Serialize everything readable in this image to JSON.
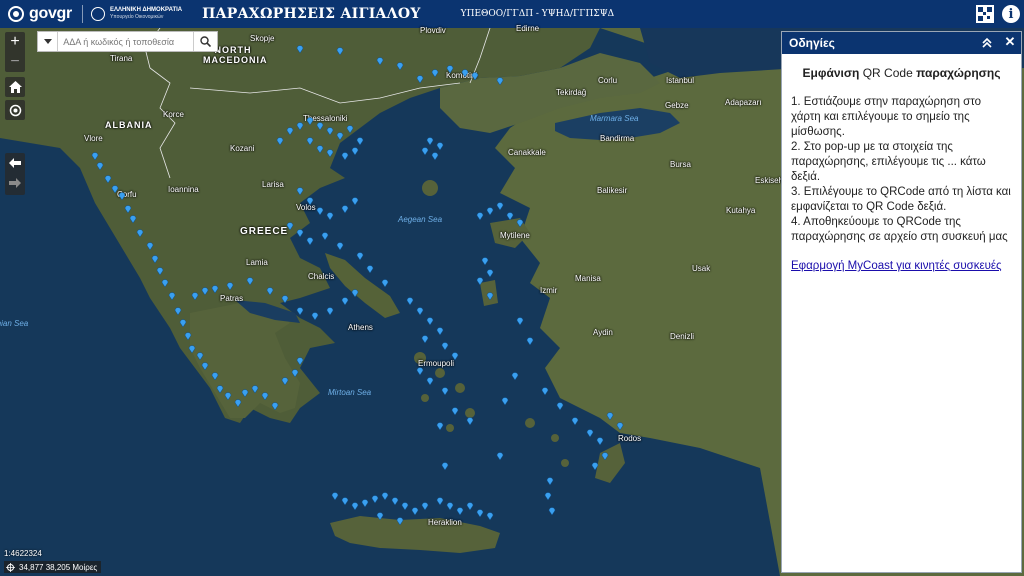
{
  "header": {
    "logo": "govgr",
    "gov_line1": "ΕΛΛΗΝΙΚΗ ΔΗΜΟΚΡΑΤΙΑ",
    "gov_line2": "Υπουργείο Οικονομικών",
    "title": "ΠΑΡΑΧΩΡΗΣΕΙΣ ΑΙΓΙΑΛΟΥ",
    "ministry": "ΥΠΕΘΟΟ/ΓΓΔΠ - ΥΨΗΔ/ΓΓΠΣΨΔ",
    "qr_icon": "qr-code-icon",
    "info_icon": "info-icon",
    "info_label": "i"
  },
  "map_controls": {
    "zoom_in": "+",
    "zoom_out": "−",
    "home_icon": "home-icon",
    "locate_icon": "locate-icon",
    "back_icon": "arrow-left-icon",
    "forward_icon": "arrow-right-icon"
  },
  "search": {
    "placeholder": "ΑΔΑ ή κωδικός ή τοποθεσία"
  },
  "map_labels": {
    "countries": [
      "NORTH MACEDONIA",
      "ALBANIA",
      "GREECE"
    ],
    "seas": [
      "Aegean Sea",
      "Marmara Sea",
      "Mirtoan Sea",
      "Ionian Sea"
    ],
    "cities": [
      "Tirana",
      "Skopje",
      "Plovdiv",
      "Edirne",
      "Istanbul",
      "Gebze",
      "Adapazarı",
      "Komotini",
      "Corlu",
      "Tekirdağ",
      "Bandirma",
      "Bursa",
      "Canakkale",
      "Balikesir",
      "Kutahya",
      "Eskisehir",
      "Thessaloniki",
      "Korce",
      "Kozani",
      "Larisa",
      "Ioannina",
      "Volos",
      "Lamia",
      "Patras",
      "Athens",
      "Mytilene",
      "Izmir",
      "Manisa",
      "Usak",
      "Aydin",
      "Denizli",
      "Ermoupoli",
      "Rodos",
      "Heraklion",
      "Corfu",
      "Vlore",
      "Chalcis"
    ]
  },
  "scale": {
    "ratio": "1:4622324",
    "coordinates": "34,877 38,205 Μοίρες"
  },
  "panel": {
    "header": "Οδηγίες",
    "collapse_icon": "double-chevron-up-icon",
    "close_icon": "close-icon",
    "close_label": "✕",
    "title_bold_1": "Εμφάνιση",
    "title_mid": " QR Code ",
    "title_bold_2": "παραχώρησης",
    "steps": [
      "1. Εστιάζουμε στην παραχώρηση στο χάρτη και επιλέγουμε το σημείο της μίσθωσης.",
      "2. Στο pop-up με τα στοιχεία της παραχώρησης, επιλέγουμε τις ... κάτω δεξιά.",
      "3. Επιλέγουμε το QRCode  από τη λίστα και εμφανίζεται το QR Code δεξιά.",
      "4. Αποθηκεύουμε το QRCode  της παραχώρησης σε αρχείο στη συσκευή μας"
    ],
    "link": "Εφαρμογή MyCoast για κινητές συσκευές"
  },
  "colors": {
    "header_bg": "#0b3470",
    "pin": "#3aa0f0",
    "sea": "#15385a",
    "land": "#4b5a36"
  }
}
